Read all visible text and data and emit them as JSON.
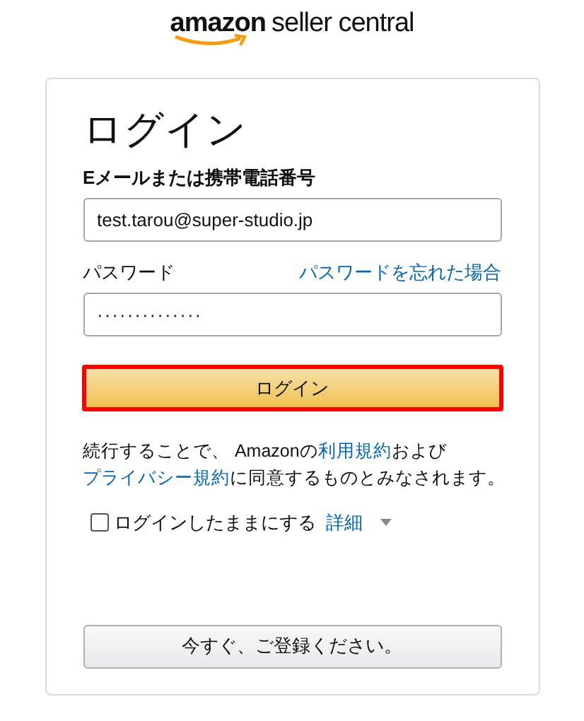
{
  "logo": {
    "brand": "amazon",
    "product": "seller central"
  },
  "title": "ログイン",
  "email": {
    "label": "Eメールまたは携帯電話番号",
    "value": "test.tarou@super-studio.jp"
  },
  "password": {
    "label": "パスワード",
    "forgot_link": "パスワードを忘れた場合",
    "value": "··············"
  },
  "login_button": {
    "label": "ログイン",
    "highlighted": true
  },
  "consent": [
    {
      "kind": "text",
      "text": "続行することで、 Amazonの"
    },
    {
      "kind": "link",
      "text": "利用規約"
    },
    {
      "kind": "text",
      "text": "および"
    },
    {
      "kind": "link",
      "text": "プライバシー規約"
    },
    {
      "kind": "text",
      "text": "に同意するものとみなされます。"
    }
  ],
  "remember": {
    "label": "ログインしたままにする",
    "checked": false,
    "details_link": "詳細"
  },
  "register_button": {
    "label": "今すぐ、ご登録ください。"
  }
}
